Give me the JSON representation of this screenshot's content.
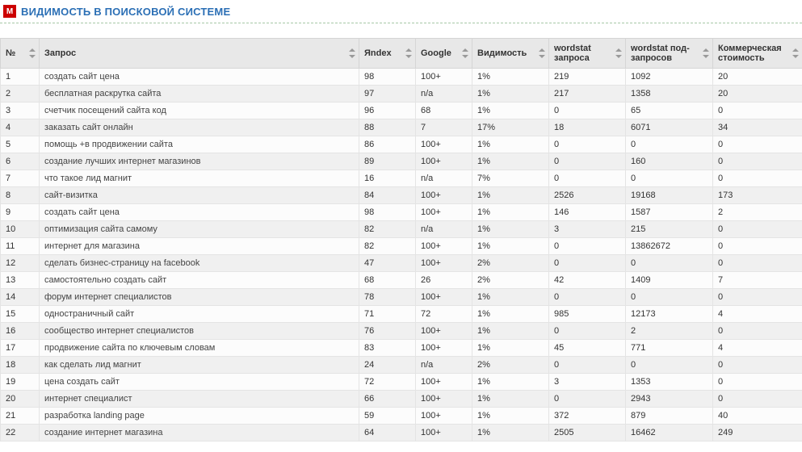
{
  "header": {
    "logo_text": "M",
    "title": "ВИДИМОСТЬ В ПОИСКОВОЙ СИСТЕМЕ"
  },
  "columns": {
    "num": "№",
    "query": "Запрос",
    "yandex": "Яndex",
    "google": "Google",
    "visibility": "Видимость",
    "wordstat_q": "wordstat запроса",
    "wordstat_sub": "wordstat под-запросов",
    "commercial": "Коммерческая стоимость"
  },
  "rows": [
    {
      "n": "1",
      "q": "создать сайт цена",
      "y": "98",
      "g": "100+",
      "v": "1%",
      "w1": "219",
      "w2": "1092",
      "c": "20"
    },
    {
      "n": "2",
      "q": "бесплатная раскрутка сайта",
      "y": "97",
      "g": "n/a",
      "v": "1%",
      "w1": "217",
      "w2": "1358",
      "c": "20"
    },
    {
      "n": "3",
      "q": "счетчик посещений сайта код",
      "y": "96",
      "g": "68",
      "v": "1%",
      "w1": "0",
      "w2": "65",
      "c": "0"
    },
    {
      "n": "4",
      "q": "заказать сайт онлайн",
      "y": "88",
      "g": "7",
      "v": "17%",
      "w1": "18",
      "w2": "6071",
      "c": "34"
    },
    {
      "n": "5",
      "q": "помощь +в продвижении сайта",
      "y": "86",
      "g": "100+",
      "v": "1%",
      "w1": "0",
      "w2": "0",
      "c": "0"
    },
    {
      "n": "6",
      "q": "создание лучших интернет магазинов",
      "y": "89",
      "g": "100+",
      "v": "1%",
      "w1": "0",
      "w2": "160",
      "c": "0"
    },
    {
      "n": "7",
      "q": "что такое лид магнит",
      "y": "16",
      "g": "n/a",
      "v": "7%",
      "w1": "0",
      "w2": "0",
      "c": "0"
    },
    {
      "n": "8",
      "q": "сайт-визитка",
      "y": "84",
      "g": "100+",
      "v": "1%",
      "w1": "2526",
      "w2": "19168",
      "c": "173"
    },
    {
      "n": "9",
      "q": "создать сайт цена",
      "y": "98",
      "g": "100+",
      "v": "1%",
      "w1": "146",
      "w2": "1587",
      "c": "2"
    },
    {
      "n": "10",
      "q": "оптимизация сайта самому",
      "y": "82",
      "g": "n/a",
      "v": "1%",
      "w1": "3",
      "w2": "215",
      "c": "0"
    },
    {
      "n": "11",
      "q": "интернет для магазина",
      "y": "82",
      "g": "100+",
      "v": "1%",
      "w1": "0",
      "w2": "13862672",
      "c": "0"
    },
    {
      "n": "12",
      "q": "сделать бизнес-страницу на facebook",
      "y": "47",
      "g": "100+",
      "v": "2%",
      "w1": "0",
      "w2": "0",
      "c": "0"
    },
    {
      "n": "13",
      "q": "самостоятельно создать сайт",
      "y": "68",
      "g": "26",
      "v": "2%",
      "w1": "42",
      "w2": "1409",
      "c": "7"
    },
    {
      "n": "14",
      "q": "форум интернет специалистов",
      "y": "78",
      "g": "100+",
      "v": "1%",
      "w1": "0",
      "w2": "0",
      "c": "0"
    },
    {
      "n": "15",
      "q": "одностраничный сайт",
      "y": "71",
      "g": "72",
      "v": "1%",
      "w1": "985",
      "w2": "12173",
      "c": "4"
    },
    {
      "n": "16",
      "q": "сообщество интернет специалистов",
      "y": "76",
      "g": "100+",
      "v": "1%",
      "w1": "0",
      "w2": "2",
      "c": "0"
    },
    {
      "n": "17",
      "q": "продвижение сайта по ключевым словам",
      "y": "83",
      "g": "100+",
      "v": "1%",
      "w1": "45",
      "w2": "771",
      "c": "4"
    },
    {
      "n": "18",
      "q": "как сделать лид магнит",
      "y": "24",
      "g": "n/a",
      "v": "2%",
      "w1": "0",
      "w2": "0",
      "c": "0"
    },
    {
      "n": "19",
      "q": "цена создать сайт",
      "y": "72",
      "g": "100+",
      "v": "1%",
      "w1": "3",
      "w2": "1353",
      "c": "0"
    },
    {
      "n": "20",
      "q": "интернет специалист",
      "y": "66",
      "g": "100+",
      "v": "1%",
      "w1": "0",
      "w2": "2943",
      "c": "0"
    },
    {
      "n": "21",
      "q": "разработка landing page",
      "y": "59",
      "g": "100+",
      "v": "1%",
      "w1": "372",
      "w2": "879",
      "c": "40"
    },
    {
      "n": "22",
      "q": "создание интернет магазина",
      "y": "64",
      "g": "100+",
      "v": "1%",
      "w1": "2505",
      "w2": "16462",
      "c": "249"
    }
  ]
}
